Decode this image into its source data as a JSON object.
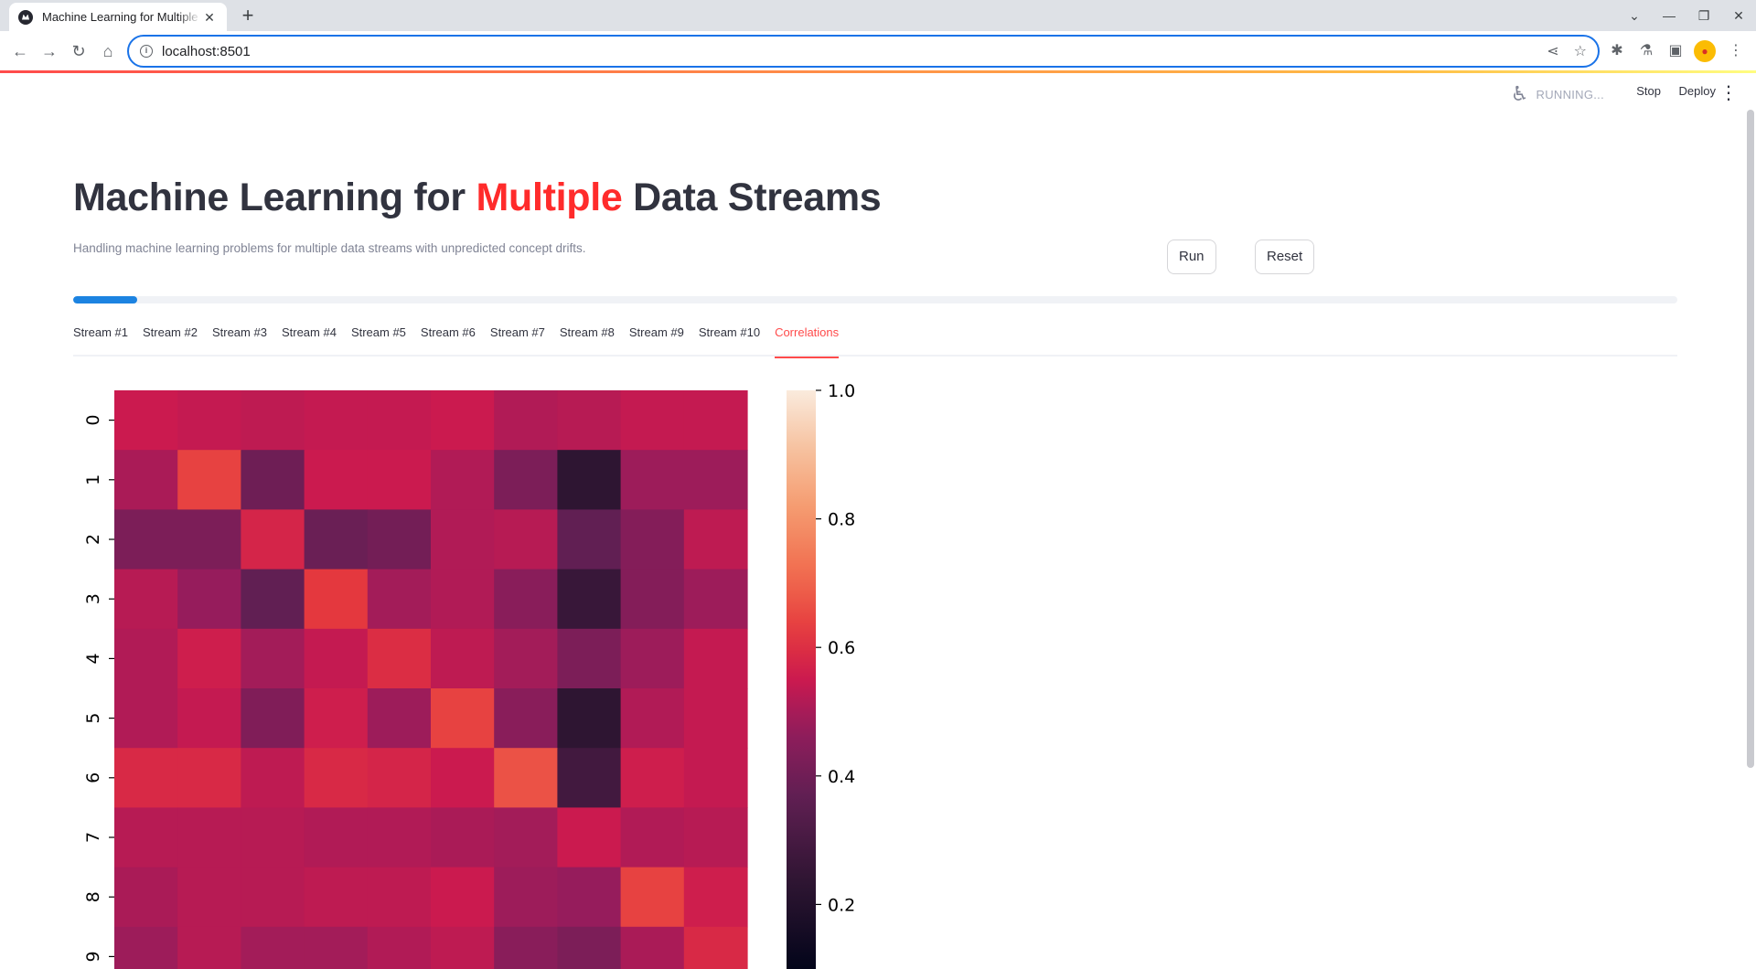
{
  "browser": {
    "tab_title": "Machine Learning for Multiple Data Streams",
    "url": "localhost:8501",
    "icons": [
      "back-icon",
      "forward-icon",
      "reload-icon",
      "home-icon",
      "info-icon",
      "share-icon",
      "star-icon",
      "puzzle-icon",
      "lab-icon",
      "sidepanel-icon",
      "profile-icon",
      "more-icon"
    ]
  },
  "header": {
    "status": "RUNNING...",
    "stop_label": "Stop",
    "deploy_label": "Deploy"
  },
  "page": {
    "title_before": "Machine Learning for ",
    "title_accent": "Multiple",
    "title_after": " Data Streams",
    "subtitle": "Handling machine learning problems for multiple data streams with unpredicted concept drifts.",
    "run_label": "Run",
    "reset_label": "Reset",
    "progress": 0.04,
    "accent_color": "#ff2b2b"
  },
  "tabs": [
    {
      "label": "Stream #1",
      "active": false
    },
    {
      "label": "Stream #2",
      "active": false
    },
    {
      "label": "Stream #3",
      "active": false
    },
    {
      "label": "Stream #4",
      "active": false
    },
    {
      "label": "Stream #5",
      "active": false
    },
    {
      "label": "Stream #6",
      "active": false
    },
    {
      "label": "Stream #7",
      "active": false
    },
    {
      "label": "Stream #8",
      "active": false
    },
    {
      "label": "Stream #9",
      "active": false
    },
    {
      "label": "Stream #10",
      "active": true
    },
    {
      "label": "Correlations",
      "active": true
    }
  ],
  "chart_data": {
    "type": "heatmap",
    "colormap": "rocket",
    "row_labels": [
      "0",
      "1",
      "2",
      "3",
      "4",
      "5",
      "6",
      "7",
      "8",
      "9"
    ],
    "col_labels": [],
    "vmin": 0.0,
    "vmax": 1.0,
    "colorbar_ticks": [
      "1.0",
      "0.8",
      "0.6",
      "0.4",
      "0.2"
    ],
    "colorbar_tick_values": [
      1.0,
      0.8,
      0.6,
      0.4,
      0.2
    ],
    "values": [
      [
        0.5,
        0.49,
        0.48,
        0.49,
        0.49,
        0.5,
        0.46,
        0.47,
        0.49,
        0.49
      ],
      [
        0.45,
        0.6,
        0.33,
        0.5,
        0.5,
        0.46,
        0.36,
        0.15,
        0.43,
        0.43
      ],
      [
        0.36,
        0.36,
        0.53,
        0.32,
        0.34,
        0.46,
        0.47,
        0.3,
        0.38,
        0.48
      ],
      [
        0.47,
        0.42,
        0.3,
        0.58,
        0.44,
        0.46,
        0.39,
        0.18,
        0.38,
        0.43
      ],
      [
        0.46,
        0.51,
        0.44,
        0.49,
        0.55,
        0.48,
        0.44,
        0.36,
        0.43,
        0.49
      ],
      [
        0.46,
        0.49,
        0.37,
        0.51,
        0.43,
        0.6,
        0.39,
        0.15,
        0.46,
        0.49
      ],
      [
        0.54,
        0.54,
        0.48,
        0.54,
        0.53,
        0.5,
        0.63,
        0.21,
        0.51,
        0.49
      ],
      [
        0.47,
        0.47,
        0.47,
        0.46,
        0.46,
        0.45,
        0.44,
        0.5,
        0.46,
        0.47
      ],
      [
        0.45,
        0.47,
        0.47,
        0.48,
        0.48,
        0.5,
        0.43,
        0.42,
        0.6,
        0.51
      ],
      [
        0.43,
        0.47,
        0.44,
        0.44,
        0.46,
        0.48,
        0.39,
        0.36,
        0.45,
        0.54
      ]
    ]
  }
}
